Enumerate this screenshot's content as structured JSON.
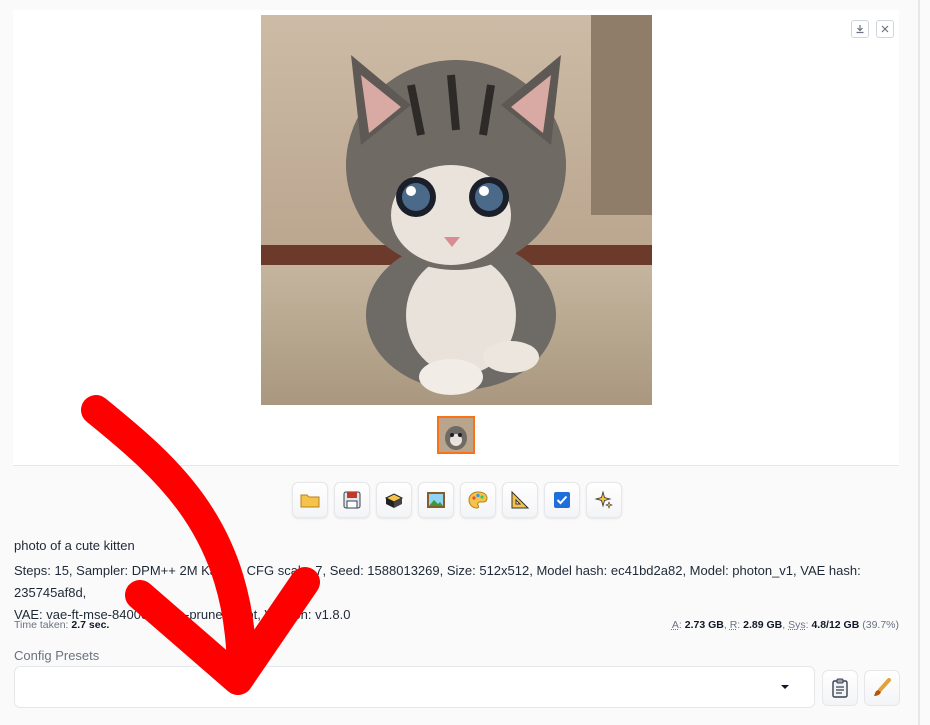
{
  "gallery": {
    "image_subject": "tabby kitten sitting on carpet",
    "download_icon": "download-icon",
    "close_icon": "close-icon"
  },
  "toolbar": {
    "buttons": [
      {
        "icon": "folder-icon"
      },
      {
        "icon": "save-icon"
      },
      {
        "icon": "zip-icon"
      },
      {
        "icon": "picture-icon"
      },
      {
        "icon": "palette-icon"
      },
      {
        "icon": "triangle-ruler-icon"
      },
      {
        "icon": "checkbox-icon"
      },
      {
        "icon": "sparkles-icon"
      }
    ]
  },
  "info": {
    "prompt": "photo of a cute kitten",
    "params_line1": "Steps: 15, Sampler: DPM++ 2M Karras, CFG scale: 7, Seed: 1588013269, Size: 512x512, Model hash: ec41bd2a82, Model: photon_v1, VAE hash: 235745af8d,",
    "params_line2": "VAE: vae-ft-mse-840000-ema-pruned.ckpt, Version: v1.8.0",
    "time_label": "Time taken:",
    "time_value": "2.7 sec.",
    "mem_a_label": "A",
    "mem_a_value": "2.73 GB",
    "mem_r_label": "R",
    "mem_r_value": "2.89 GB",
    "mem_sys_label": "Sys",
    "mem_sys_value": "4.8/12 GB",
    "mem_pct": "(39.7%)"
  },
  "presets": {
    "label": "Config Presets",
    "selected": "",
    "copy_icon": "clipboard-icon",
    "edit_icon": "brush-icon"
  },
  "colors": {
    "accent": "#f97316",
    "arrow": "#ff0000"
  }
}
